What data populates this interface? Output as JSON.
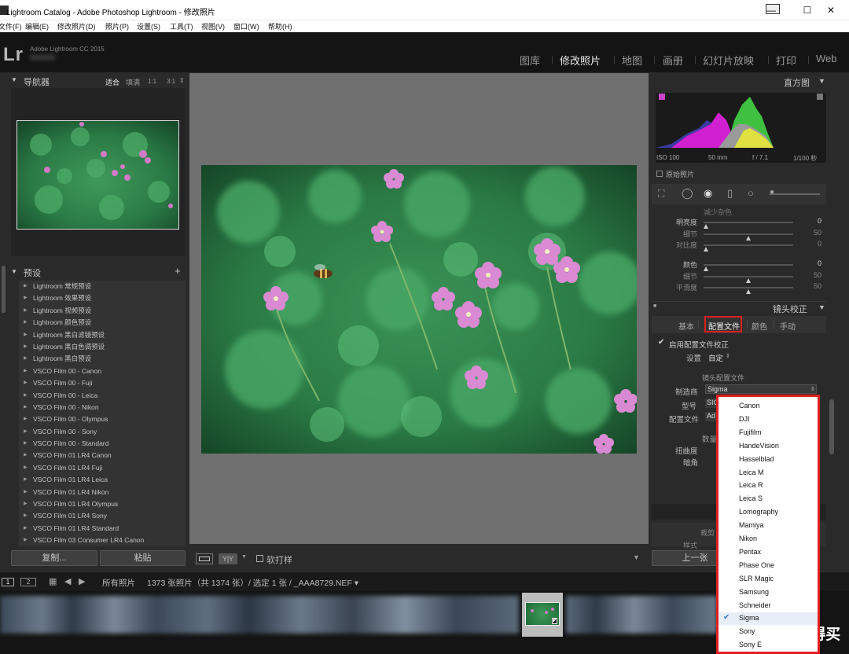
{
  "window": {
    "title": "Lightroom Catalog - Adobe Photoshop Lightroom - 修改照片",
    "minimize": "—",
    "maximize": "☐",
    "close": "✕"
  },
  "menu": [
    "文件(F)",
    "编辑(E)",
    "修改照片(D)",
    "照片(P)",
    "设置(S)",
    "工具(T)",
    "视图(V)",
    "窗口(W)",
    "帮助(H)"
  ],
  "identity": {
    "logo": "Lr",
    "app_name": "Adobe Lightroom CC 2015"
  },
  "modules": [
    "图库",
    "修改照片",
    "地图",
    "画册",
    "幻灯片放映",
    "打印",
    "Web"
  ],
  "left": {
    "navigator": {
      "title": "导航器",
      "zoom": [
        "适合",
        "填满",
        "1:1",
        "3:1"
      ]
    },
    "presets": {
      "title": "预设",
      "add": "+",
      "items": [
        "Lightroom 常规预设",
        "Lightroom 效果预设",
        "Lightroom 视频预设",
        "Lightroom 颜色预设",
        "Lightroom 黑白滤镜预设",
        "Lightroom 黑白色调预设",
        "Lightroom 黑白预设",
        "VSCO Film 00 - Canon",
        "VSCO Film 00 - Fuji",
        "VSCO Film 00 - Leica",
        "VSCO Film 00 - Nikon",
        "VSCO Film 00 - Olympus",
        "VSCO Film 00 - Sony",
        "VSCO Film 00 - Standard",
        "VSCO Film 01 LR4 Canon",
        "VSCO Film 01 LR4 Fuji",
        "VSCO Film 01 LR4 Leica",
        "VSCO Film 01 LR4 Nikon",
        "VSCO Film 01 LR4 Olympus",
        "VSCO Film 01 LR4 Sony",
        "VSCO Film 01 LR4 Standard",
        "VSCO Film 03 Consumer LR4 Canon"
      ]
    },
    "copy_button": "复制...",
    "paste_button": "粘贴"
  },
  "toolbar": {
    "soft_proof": "软打样"
  },
  "right": {
    "histogram": {
      "title": "直方图",
      "iso": "ISO 100",
      "focal": "50 mm",
      "aperture": "f / 7.1",
      "shutter": "1/100 秒",
      "original_photo": "原始照片"
    },
    "detail": {
      "partial_header": "减少杂色",
      "sliders": [
        {
          "label": "明亮度",
          "value": "0",
          "pos": 0
        },
        {
          "label": "细节",
          "value": "50",
          "pos": 0.5
        },
        {
          "label": "对比度",
          "value": "0",
          "pos": 0
        },
        {
          "label": "颜色",
          "value": "0",
          "pos": 0
        },
        {
          "label": "细节",
          "value": "50",
          "pos": 0.5
        },
        {
          "label": "平滑度",
          "value": "50",
          "pos": 0.5
        }
      ]
    },
    "lens": {
      "title": "镜头校正",
      "tabs": [
        "基本",
        "配置文件",
        "颜色",
        "手动"
      ],
      "active_tab": "配置文件",
      "enable_profile": "启用配置文件校正",
      "setup_label": "设置",
      "setup_value": "自定",
      "section_title": "镜头配置文件",
      "make_label": "制造商",
      "make_value": "Sigma",
      "model_label": "型号",
      "model_value": "SIG",
      "profile_label": "配置文件",
      "profile_value": "Ad",
      "amount_label": "数量",
      "distortion_label": "扭曲度",
      "vignette_label": "暗角"
    },
    "crop_partial": "裁剪",
    "style_partial": "样式",
    "prev_button": "上一张"
  },
  "dropdown": {
    "items": [
      "Canon",
      "DJI",
      "Fujifilm",
      "HandeVision",
      "Hasselblad",
      "Leica M",
      "Leica R",
      "Leica S",
      "Lomography",
      "Mamiya",
      "Nikon",
      "Pentax",
      "Phase One",
      "SLR Magic",
      "Samsung",
      "Schneider",
      "Sigma",
      "Sony",
      "Sony E"
    ],
    "selected": "Sigma"
  },
  "filmbar": {
    "page1": "1",
    "page2": "2",
    "source": "所有照片",
    "summary": "1373 张照片（共 1374 张）/ 选定 1 张 / _AAA8729.NEF ▾"
  },
  "watermark": "值 什么值得买",
  "colors": {
    "highlight": "#e02020",
    "panel": "#2a2a2a",
    "center": "#707070"
  }
}
